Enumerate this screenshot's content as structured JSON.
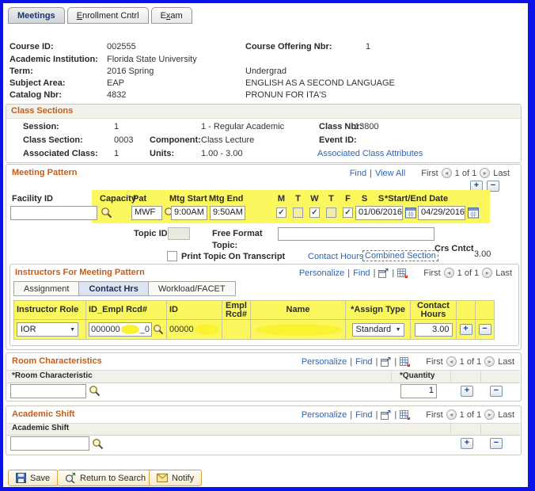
{
  "ui": {
    "sep": "|",
    "prev": "◂",
    "next": "▸",
    "plus": "+",
    "minus": "−",
    "dd": "▼"
  },
  "tabs": {
    "meetings": "Meetings",
    "enrollment_key": "E",
    "enrollment_rest": "nrollment Cntrl",
    "exam_pre": "E",
    "exam_key": "x",
    "exam_rest": "am"
  },
  "header": {
    "course_id_label": "Course ID:",
    "course_id": "002555",
    "offering_label": "Course Offering Nbr:",
    "offering_value": "1",
    "institution_label": "Academic Institution:",
    "institution": "Florida State University",
    "term_label": "Term:",
    "term": "2016 Spring",
    "career": "Undergrad",
    "subject_label": "Subject Area:",
    "subject": "EAP",
    "subject_desc": "ENGLISH AS A SECOND LANGUAGE",
    "catalog_label": "Catalog Nbr:",
    "catalog": "4832",
    "catalog_desc": "PRONUN FOR ITA'S"
  },
  "class_sections": {
    "title": "Class Sections",
    "session_label": "Session:",
    "session": "1",
    "session_desc": "1 - Regular Academic",
    "class_nbr_label": "Class Nbr:",
    "class_nbr": "13800",
    "section_label": "Class Section:",
    "section": "0003",
    "component_label": "Component:",
    "component": "Class Lecture",
    "event_id_label": "Event ID:",
    "assoc_label": "Associated Class:",
    "assoc": "1",
    "units_label": "Units:",
    "units": "1.00 - 3.00",
    "attributes_link": "Associated Class Attributes"
  },
  "meeting_pattern": {
    "title": "Meeting Pattern",
    "find": "Find",
    "view_all": "View All",
    "first": "First",
    "page": "1 of 1",
    "last": "Last",
    "facility_label": "Facility ID",
    "col_capacity": "Capacity",
    "col_pat": "Pat",
    "col_mtg_start": "Mtg Start",
    "col_mtg_end": "Mtg End",
    "days": [
      "M",
      "T",
      "W",
      "T",
      "F",
      "S",
      "S"
    ],
    "day_marks": [
      "✓",
      "",
      "✓",
      "",
      "✓",
      "",
      ""
    ],
    "col_start_end": "*Start/End Date",
    "pat": "MWF",
    "mtg_start": "9:00AM",
    "mtg_end": "9:50AM",
    "start_date": "01/06/2016",
    "end_date": "04/29/2016",
    "topic_id_label": "Topic ID:",
    "free_format_label_1": "Free Format",
    "free_format_label_2": "Topic:",
    "print_topic_label": "Print Topic On Transcript",
    "contact_hours_link": "Contact Hours",
    "combined_section_link": "Combined Section",
    "crs_cntct_label": "Crs Cntct",
    "crs_cntct": "3.00"
  },
  "instructors": {
    "title": "Instructors For Meeting Pattern",
    "personalize": "Personalize",
    "find": "Find",
    "first": "First",
    "page": "1 of 1",
    "last": "Last",
    "tabs": [
      "Assignment",
      "Contact Hrs",
      "Workload/FACET"
    ],
    "col_role": "Instructor Role",
    "col_id_empl": "ID_Empl Rcd#",
    "col_id": "ID",
    "col_empl_1": "Empl",
    "col_empl_2": "Rcd#",
    "col_name": "Name",
    "col_assign": "*Assign Type",
    "col_contact_1": "Contact",
    "col_contact_2": "Hours",
    "row": {
      "role": "IOR",
      "id_empl_left": "000000",
      "id_empl_right": "_0",
      "id_left": "00000",
      "assign_type": "Standard",
      "contact_hours": "3.00"
    }
  },
  "room": {
    "title": "Room Characteristics",
    "personalize": "Personalize",
    "find": "Find",
    "first": "First",
    "page": "1 of 1",
    "last": "Last",
    "col_characteristic": "*Room Characteristic",
    "col_quantity": "*Quantity",
    "quantity": "1"
  },
  "shift": {
    "title": "Academic Shift",
    "personalize": "Personalize",
    "find": "Find",
    "first": "First",
    "page": "1 of 1",
    "last": "Last",
    "col_shift": "Academic Shift"
  },
  "toolbar": {
    "save": "Save",
    "return": "Return to Search",
    "notify": "Notify"
  }
}
